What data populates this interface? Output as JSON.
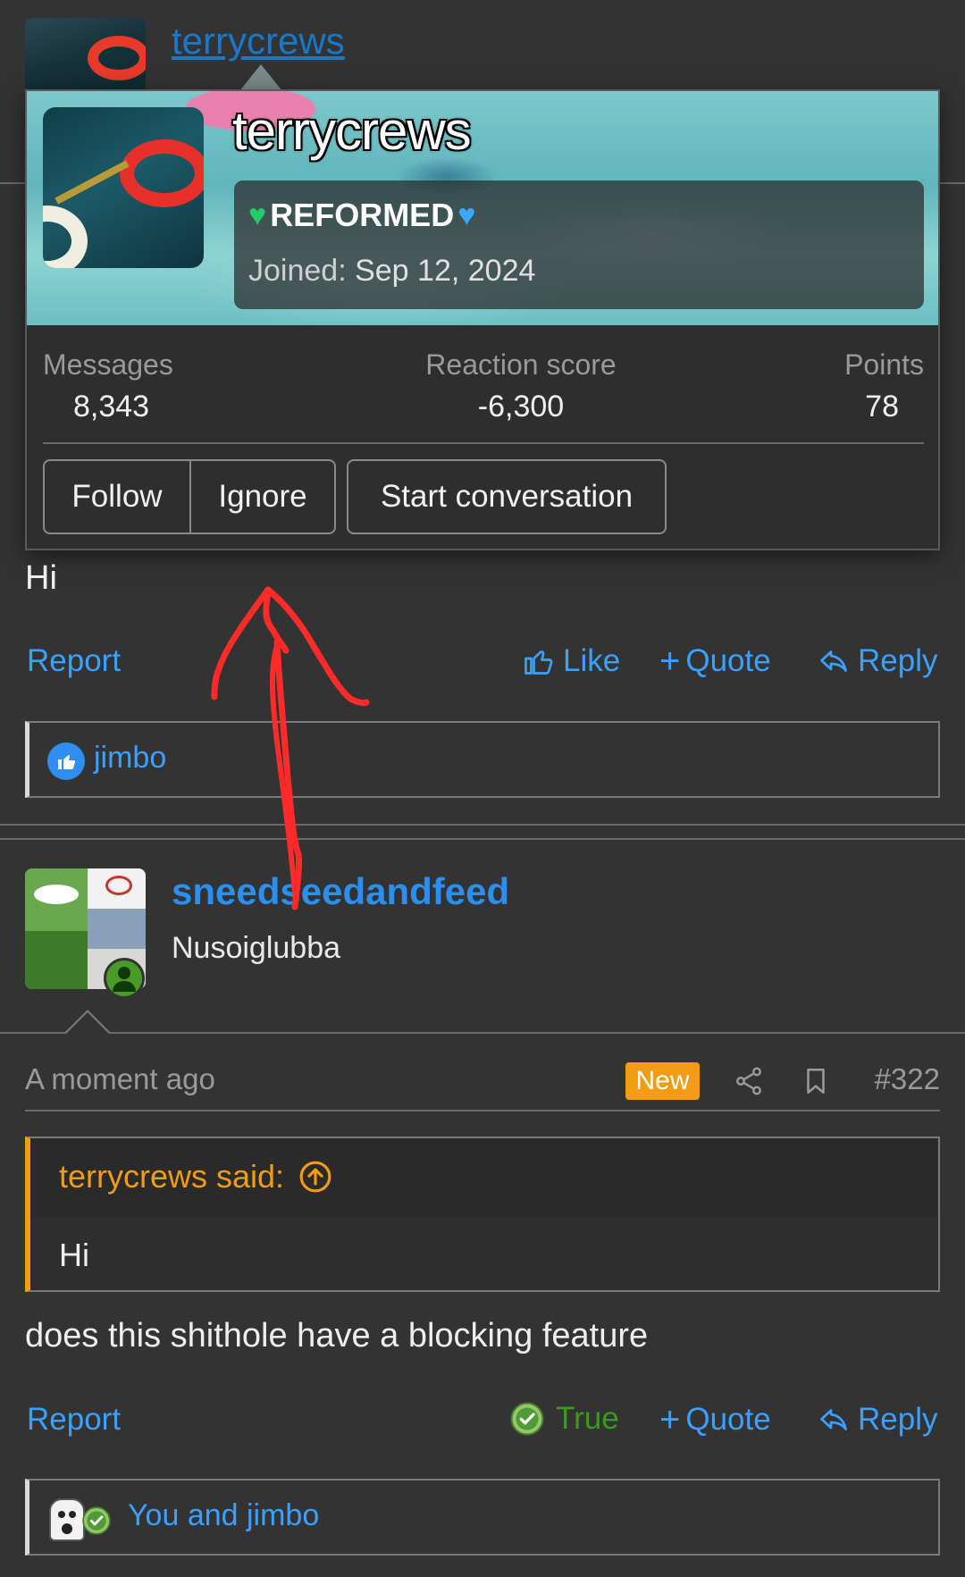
{
  "top_post": {
    "username": "terrycrews"
  },
  "profile_card": {
    "username": "terrycrews",
    "title_left_icon": "green-heart-icon",
    "title": "REFORMED",
    "title_right_icon": "blue-heart-icon",
    "joined_label": "Joined:",
    "joined_date": "Sep 12, 2024",
    "stats": [
      {
        "label": "Messages",
        "value": "8,343"
      },
      {
        "label": "Reaction score",
        "value": "-6,300"
      },
      {
        "label": "Points",
        "value": "78"
      }
    ],
    "buttons": {
      "follow": "Follow",
      "ignore": "Ignore",
      "start_conversation": "Start conversation"
    }
  },
  "post1": {
    "body": "Hi",
    "report": "Report",
    "like": "Like",
    "quote": "Quote",
    "reply": "Reply",
    "reactions": "jimbo"
  },
  "post2": {
    "username": "sneedseedandfeed",
    "user_title": "Nusoiglubba",
    "time": "A moment ago",
    "badge": "New",
    "post_number": "#322",
    "quote": {
      "author": "terrycrews said:",
      "text": "Hi"
    },
    "body": "does this shithole have a blocking feature",
    "report": "Report",
    "reaction_given": "True",
    "quote_label": "Quote",
    "reply": "Reply",
    "reactions": "You and jimbo"
  },
  "colors": {
    "background": "#333333",
    "link": "#3aa0ff",
    "accent_orange": "#f39c12",
    "true_green": "#3a9a1a",
    "annotation_red": "#ff2a2a"
  }
}
